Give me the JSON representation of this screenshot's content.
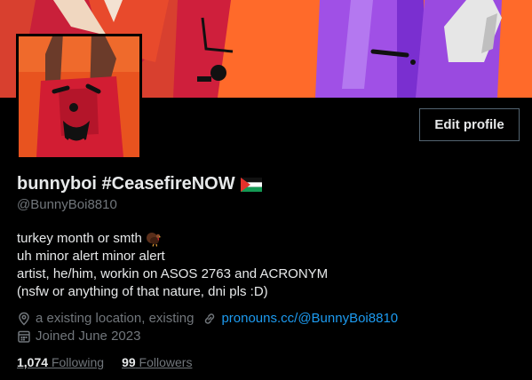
{
  "profile": {
    "display_name": "bunnyboi #CeasefireNOW",
    "handle": "@BunnyBoi8810",
    "bio_lines": [
      "turkey month or smth",
      "uh minor alert minor alert",
      "artist, he/him, workin on ASOS 2763 and ACRONYM",
      "(nsfw or anything of that nature, dni pls :D)"
    ],
    "location": "a existing location, existing",
    "website": "pronouns.cc/@BunnyBoi8810",
    "joined": "Joined June 2023",
    "following_count": "1,074",
    "following_label": "Following",
    "followers_count": "99",
    "followers_label": "Followers"
  },
  "buttons": {
    "edit_profile": "Edit profile"
  },
  "icons": {
    "name_flag": "palestine-flag-icon",
    "bio_emoji": "turkey-icon",
    "location": "location-pin-icon",
    "website": "link-icon",
    "joined": "calendar-icon"
  },
  "colors": {
    "background": "#000000",
    "text_primary": "#e7e9ea",
    "text_secondary": "#71767b",
    "link": "#1d9bf0",
    "button_border": "#536471"
  }
}
